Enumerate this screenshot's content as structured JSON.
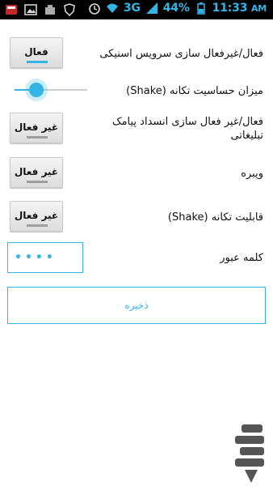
{
  "status_bar": {
    "network": "3G",
    "battery": "44%",
    "time": "11:33",
    "ampm": "AM",
    "icons": [
      "notification-icon",
      "gallery-icon",
      "app-icon",
      "shield-icon",
      "alarm-icon",
      "wifi-icon",
      "signal-icon",
      "battery-icon"
    ]
  },
  "settings": {
    "service": {
      "label": "فعال/غیرفعال سازی سرویس اسنیکی",
      "button": "فعال",
      "state": "on"
    },
    "sensitivity": {
      "label": "میزان حساسیت تکانه (Shake)",
      "value_fraction": 0.25
    },
    "ad_block": {
      "label": "فعال/غیر فعال سازی انسداد پیامک تبلیغاتی",
      "button": "غیر فعال",
      "state": "off"
    },
    "vibrate": {
      "label": "ویبره",
      "button": "غیر فعال",
      "state": "off"
    },
    "shake": {
      "label": "قابلیت تکانه (Shake)",
      "button": "غیر فعال",
      "state": "off"
    },
    "password": {
      "label": "کلمه عبور",
      "value": "••••"
    }
  },
  "save_button": "ذخیره",
  "colors": {
    "accent": "#33b5e5",
    "statusbar_bg": "#000000",
    "background": "#ffffff"
  }
}
